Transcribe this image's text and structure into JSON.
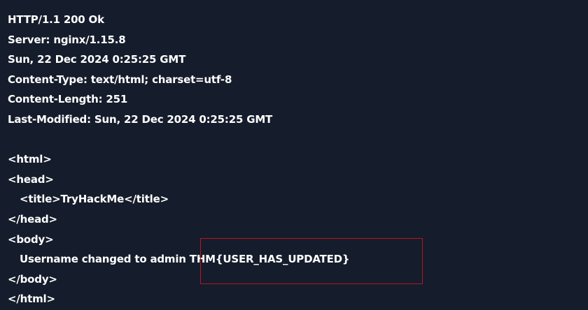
{
  "response": {
    "headers": [
      "HTTP/1.1 200 Ok",
      "Server: nginx/1.15.8",
      "Sun, 22 Dec 2024 0:25:25 GMT",
      "Content-Type: text/html; charset=utf-8",
      "Content-Length: 251",
      "Last-Modified: Sun, 22 Dec 2024 0:25:25 GMT"
    ],
    "body": {
      "html_open": "<html>",
      "head_open": "<head>",
      "title_line": "<title>TryHackMe</title>",
      "head_close": "</head>",
      "body_open": "<body>",
      "message_prefix": "Username changed to admin ",
      "flag": "THM{USER_HAS_UPDATED}",
      "body_close": "</body>",
      "html_close": "</html>"
    }
  },
  "highlight": {
    "color": "#c1121f"
  },
  "colors": {
    "background": "#151c2b",
    "text": "#ffffff"
  }
}
